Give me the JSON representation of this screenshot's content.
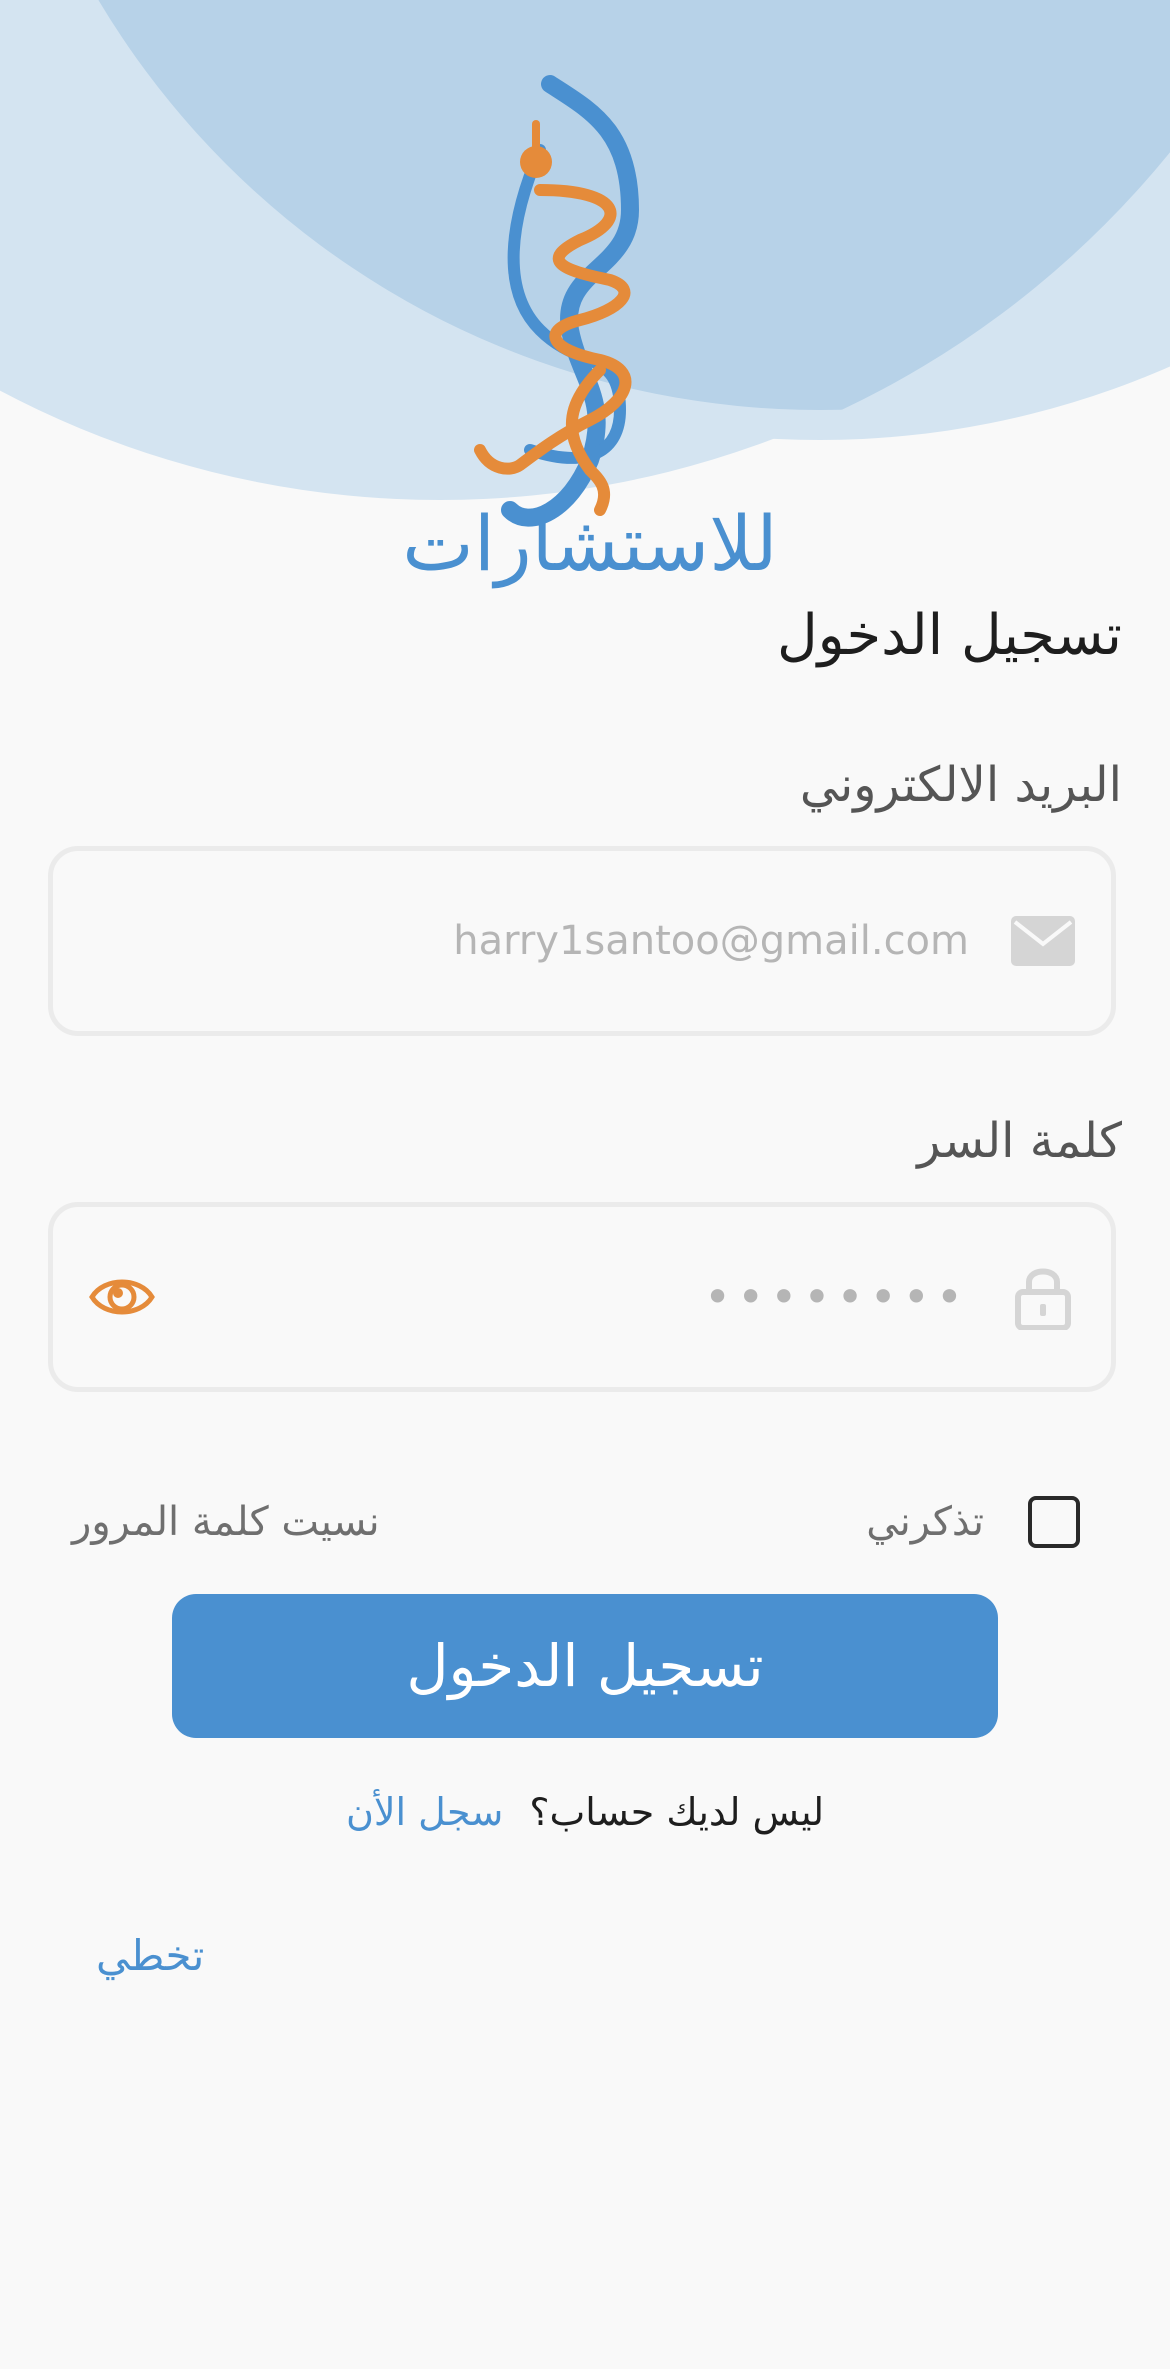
{
  "brand": {
    "logo_text": "للاستشارات"
  },
  "page_title": "تسجيل الدخول",
  "email": {
    "label": "البريد الالكتروني",
    "placeholder": "harry1santoo@gmail.com",
    "icon": "mail-icon"
  },
  "password": {
    "label": "كلمة السر",
    "value": "••••••••",
    "lock_icon": "lock-icon",
    "toggle_icon": "eye-icon"
  },
  "remember_me": {
    "label": "تذكرني",
    "checked": false
  },
  "forgot_password": "نسيت كلمة المرور",
  "login_button": "تسجيل الدخول",
  "signup": {
    "prompt": "ليس لديك حساب؟",
    "link": "سجل الأن"
  },
  "skip": "تخطي",
  "colors": {
    "primary": "#4a90d0",
    "accent": "#e58b3a",
    "background": "#f9f9f9",
    "circle_light": "#d4e4f1",
    "circle_mid": "#b7d3e9"
  }
}
